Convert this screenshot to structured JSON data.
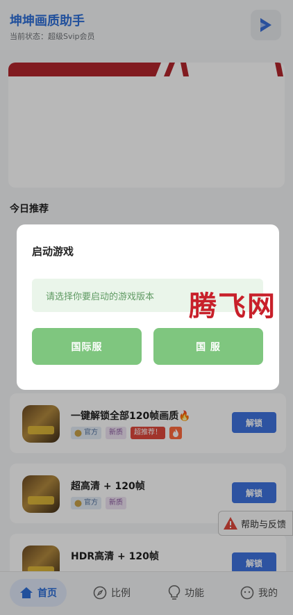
{
  "header": {
    "title": "坤坤画质助手",
    "status": "当前状态：超级Svip会员"
  },
  "colors": {
    "brand": "#2f6fd8",
    "unlock": "#3f73df",
    "dialog_button": "#7fc67f",
    "watermark": "#c8202a"
  },
  "sections": {
    "today_title": "今日推荐"
  },
  "items": [
    {
      "name": "一键解锁全部120帧画质🔥",
      "tag_official": "官方",
      "tag_new": "新质",
      "tag_hot": "超推荐！",
      "unlock": "解锁"
    },
    {
      "name": "超高清 + 120帧",
      "tag_official": "官方",
      "tag_new": "新质",
      "unlock": "解锁"
    },
    {
      "name": "HDR高清 + 120帧",
      "unlock": "解锁"
    }
  ],
  "help": {
    "label": "帮助与反馈",
    "icon": "warning-icon"
  },
  "tabs": [
    {
      "label": "首页",
      "icon": "home-icon"
    },
    {
      "label": "比例",
      "icon": "compass-icon"
    },
    {
      "label": "功能",
      "icon": "bulb-icon"
    },
    {
      "label": "我的",
      "icon": "face-icon"
    }
  ],
  "dialog": {
    "title": "启动游戏",
    "message": "请选择你要启动的游戏版本",
    "btn_international": "国际服",
    "btn_domestic": "国 服"
  },
  "watermark": "腾飞网"
}
